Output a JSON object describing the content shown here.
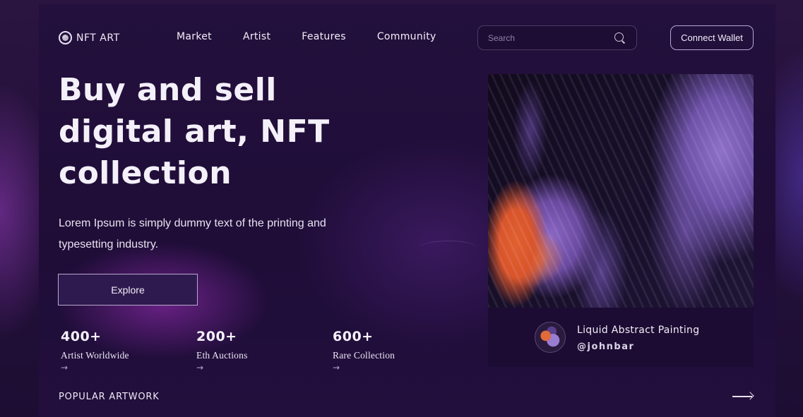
{
  "nav": {
    "logo_text": "NFT ART",
    "links": [
      "Market",
      "Artist",
      "Features",
      "Community"
    ],
    "search_placeholder": "Search",
    "connect_label": "Connect Wallet"
  },
  "hero": {
    "title": "Buy and sell digital art, NFT collection",
    "description": "Lorem Ipsum is simply dummy text of the printing and typesetting industry.",
    "explore_label": "Explore"
  },
  "stats": [
    {
      "value": "400+",
      "label": "Artist Worldwide",
      "arrow": "→"
    },
    {
      "value": "200+",
      "label": "Eth Auctions",
      "arrow": "→"
    },
    {
      "value": "600+",
      "label": "Rare Collection",
      "arrow": "→"
    }
  ],
  "popular": {
    "label": "POPULAR ARTWORK"
  },
  "artwork": {
    "title": "Liquid Abstract Painting",
    "author": "@johnbar"
  },
  "colors": {
    "background": "#1f0d38",
    "accent": "#b9a7d6",
    "art_orange": "#e0602e",
    "art_purple": "#8e71c9"
  }
}
